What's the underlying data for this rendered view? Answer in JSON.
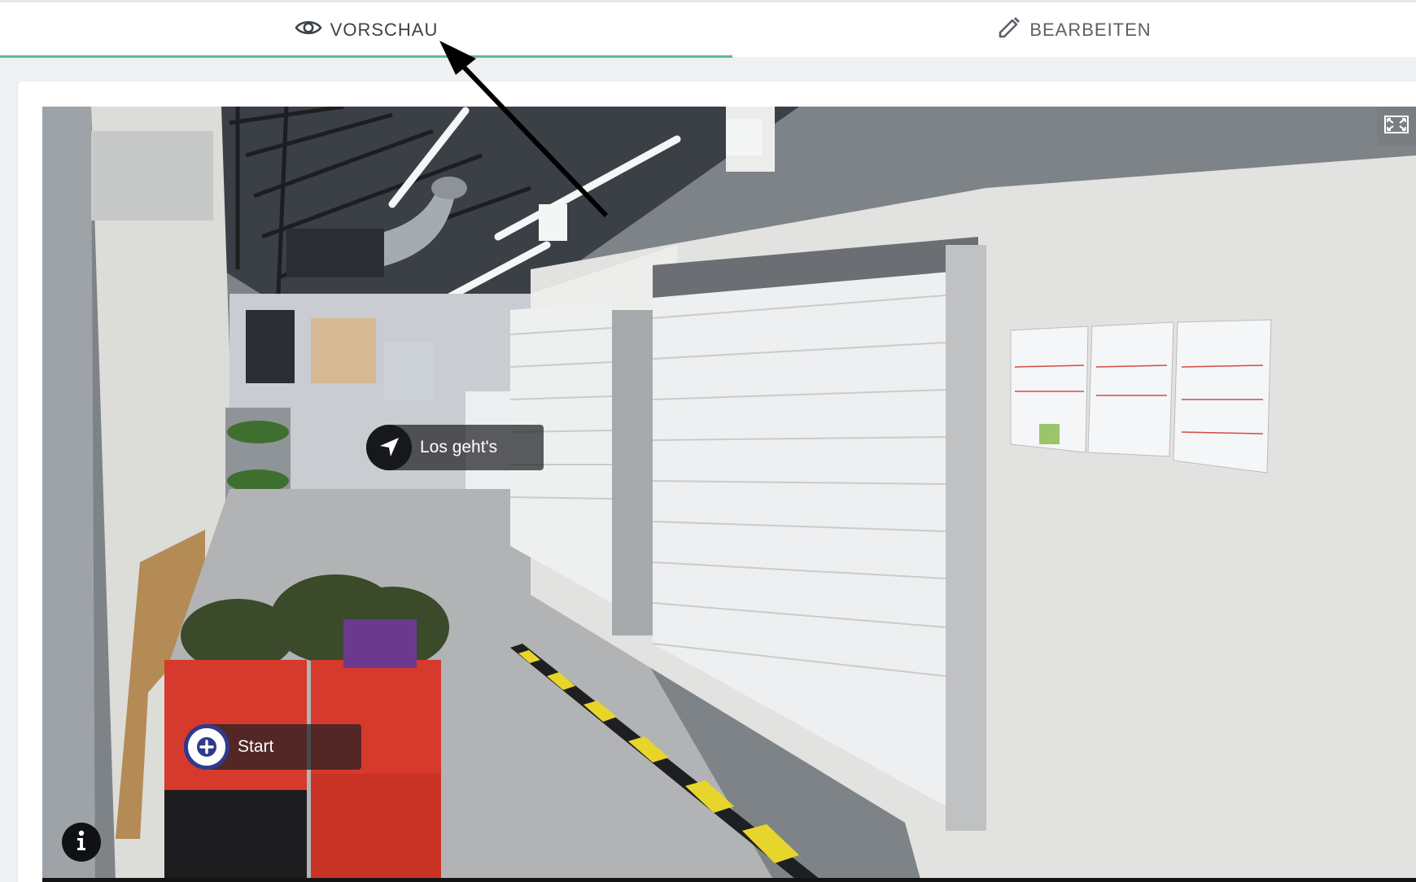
{
  "tabs": {
    "preview_label": "VORSCHAU",
    "edit_label": "BEARBEITEN",
    "active": "VORSCHAU",
    "preview_icon": "eye-icon",
    "edit_icon": "pencil-icon"
  },
  "viewer": {
    "hotspots": [
      {
        "label": "Los geht's",
        "icon": "navigation-arrow-icon"
      },
      {
        "label": "Start",
        "icon": "plus-circle-icon"
      }
    ],
    "fullscreen_icon": "fullscreen-icon",
    "info_icon": "info-icon"
  },
  "colors": {
    "accent": "#5fb89a",
    "start_ring": "#2f3a8c"
  }
}
